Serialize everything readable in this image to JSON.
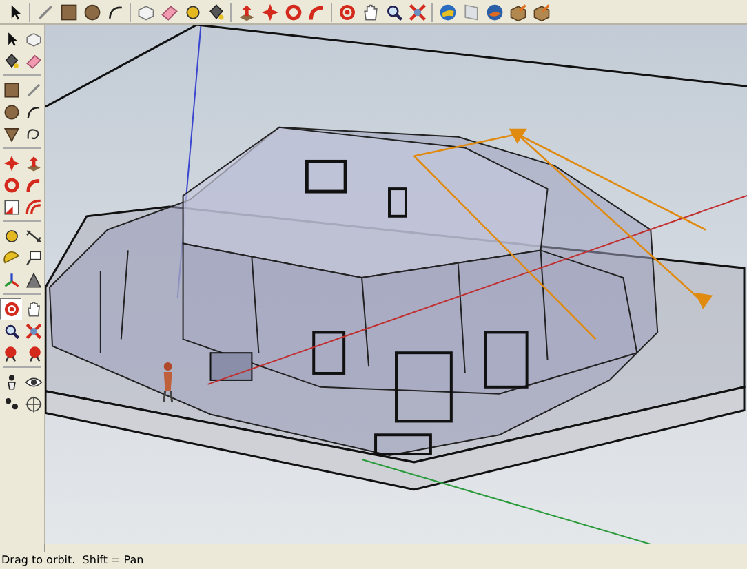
{
  "top_toolbar": {
    "groups": [
      {
        "tools": [
          {
            "kind": "select",
            "selected": false
          }
        ]
      },
      {
        "tools": [
          {
            "kind": "line",
            "selected": false
          },
          {
            "kind": "rectangle",
            "selected": false
          },
          {
            "kind": "circle",
            "selected": false
          },
          {
            "kind": "arc",
            "selected": false
          }
        ]
      },
      {
        "tools": [
          {
            "kind": "component",
            "selected": false
          },
          {
            "kind": "eraser",
            "selected": false
          },
          {
            "kind": "tape",
            "selected": false
          },
          {
            "kind": "paint",
            "selected": false
          }
        ]
      },
      {
        "tools": [
          {
            "kind": "pushpull",
            "selected": false
          },
          {
            "kind": "move",
            "selected": false
          },
          {
            "kind": "rotate",
            "selected": false
          },
          {
            "kind": "followme",
            "selected": false
          }
        ]
      },
      {
        "tools": [
          {
            "kind": "orbit",
            "selected": false
          },
          {
            "kind": "pan",
            "selected": false
          },
          {
            "kind": "zoom",
            "selected": false
          },
          {
            "kind": "zoomextents",
            "selected": false
          }
        ]
      },
      {
        "tools": [
          {
            "kind": "globe",
            "selected": false
          },
          {
            "kind": "page",
            "selected": false
          },
          {
            "kind": "sphere",
            "selected": false
          },
          {
            "kind": "box",
            "selected": false
          },
          {
            "kind": "box",
            "selected": false
          }
        ]
      }
    ]
  },
  "left_toolbar": {
    "groups": [
      {
        "tools": [
          {
            "kind": "select",
            "selected": false
          },
          {
            "kind": "component",
            "selected": false
          },
          {
            "kind": "paint",
            "selected": false
          },
          {
            "kind": "eraser",
            "selected": false
          }
        ]
      },
      {
        "tools": [
          {
            "kind": "rectangle",
            "selected": false
          },
          {
            "kind": "line",
            "selected": false
          },
          {
            "kind": "circle",
            "selected": false
          },
          {
            "kind": "arc",
            "selected": false
          },
          {
            "kind": "polygon",
            "selected": false
          },
          {
            "kind": "freehand",
            "selected": false
          }
        ]
      },
      {
        "tools": [
          {
            "kind": "move",
            "selected": false
          },
          {
            "kind": "pushpull",
            "selected": false
          },
          {
            "kind": "rotate",
            "selected": false
          },
          {
            "kind": "followme",
            "selected": false
          },
          {
            "kind": "scale",
            "selected": false
          },
          {
            "kind": "offset",
            "selected": false
          }
        ]
      },
      {
        "tools": [
          {
            "kind": "tape",
            "selected": false
          },
          {
            "kind": "dimension",
            "selected": false
          },
          {
            "kind": "protractor",
            "selected": false
          },
          {
            "kind": "text",
            "selected": false
          },
          {
            "kind": "axes",
            "selected": false
          },
          {
            "kind": "pyramid",
            "selected": false
          }
        ]
      },
      {
        "tools": [
          {
            "kind": "orbit",
            "selected": true
          },
          {
            "kind": "pan",
            "selected": false
          },
          {
            "kind": "zoom",
            "selected": false
          },
          {
            "kind": "zoomextents",
            "selected": false
          },
          {
            "kind": "prev",
            "selected": false
          },
          {
            "kind": "next",
            "selected": false
          }
        ]
      },
      {
        "tools": [
          {
            "kind": "walk",
            "selected": false
          },
          {
            "kind": "eye",
            "selected": false
          },
          {
            "kind": "footprints",
            "selected": false
          },
          {
            "kind": "section",
            "selected": false
          }
        ]
      }
    ]
  },
  "status_bar": {
    "text": "Drag to orbit.  Shift = Pan"
  }
}
